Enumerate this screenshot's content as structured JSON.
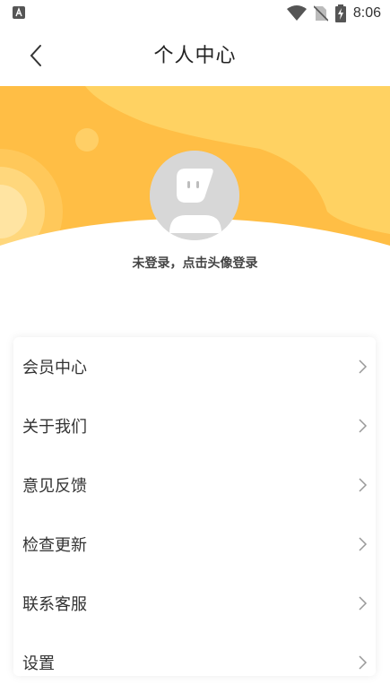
{
  "status_bar": {
    "time": "8:06",
    "icons": [
      "app-notification-icon",
      "wifi-icon",
      "no-sim-icon",
      "battery-charging-icon"
    ]
  },
  "header": {
    "title": "个人中心",
    "back_icon": "chevron-left-icon"
  },
  "profile": {
    "login_hint": "未登录，点击头像登录",
    "avatar_icon": "default-avatar-icon"
  },
  "menu": {
    "items": [
      {
        "label": "会员中心",
        "icon": "chevron-right-icon"
      },
      {
        "label": "关于我们",
        "icon": "chevron-right-icon"
      },
      {
        "label": "意见反馈",
        "icon": "chevron-right-icon"
      },
      {
        "label": "检查更新",
        "icon": "chevron-right-icon"
      },
      {
        "label": "联系客服",
        "icon": "chevron-right-icon"
      },
      {
        "label": "设置",
        "icon": "chevron-right-icon"
      }
    ]
  },
  "colors": {
    "banner_primary": "#ffc34d",
    "banner_light": "#ffd66b",
    "avatar_bg": "#d7d7d7",
    "text_primary": "#333333"
  }
}
